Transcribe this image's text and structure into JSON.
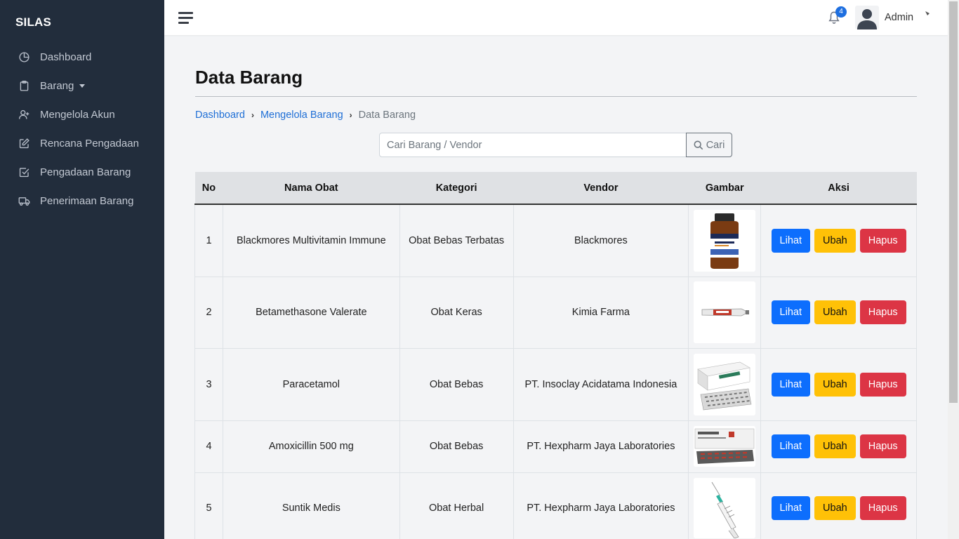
{
  "app": {
    "brand": "SILAS"
  },
  "sidebar": {
    "items": [
      {
        "label": "Dashboard",
        "icon": "pie-chart-icon"
      },
      {
        "label": "Barang",
        "icon": "clipboard-icon",
        "has_dropdown": true
      },
      {
        "label": "Mengelola Akun",
        "icon": "user-plus-icon"
      },
      {
        "label": "Rencana Pengadaan",
        "icon": "edit-icon"
      },
      {
        "label": "Pengadaan Barang",
        "icon": "check-square-icon"
      },
      {
        "label": "Penerimaan Barang",
        "icon": "truck-icon"
      }
    ]
  },
  "topbar": {
    "notification_count": "4",
    "username": "Admin"
  },
  "page": {
    "title": "Data Barang",
    "breadcrumb": [
      {
        "label": "Dashboard"
      },
      {
        "label": "Mengelola Barang"
      },
      {
        "label": "Data Barang"
      }
    ]
  },
  "search": {
    "placeholder": "Cari Barang / Vendor",
    "button_label": "Cari"
  },
  "table": {
    "headers": [
      "No",
      "Nama Obat",
      "Kategori",
      "Vendor",
      "Gambar",
      "Aksi"
    ],
    "action_labels": {
      "view": "Lihat",
      "edit": "Ubah",
      "delete": "Hapus"
    },
    "rows": [
      {
        "no": "1",
        "nama": "Blackmores Multivitamin Immune",
        "kategori": "Obat Bebas Terbatas",
        "vendor": "Blackmores",
        "image": "vitamin-bottle-image"
      },
      {
        "no": "2",
        "nama": "Betamethasone Valerate",
        "kategori": "Obat Keras",
        "vendor": "Kimia Farma",
        "image": "ointment-tube-image"
      },
      {
        "no": "3",
        "nama": "Paracetamol",
        "kategori": "Obat Bebas",
        "vendor": "PT. Insoclay Acidatama Indonesia",
        "image": "paracetamol-box-image"
      },
      {
        "no": "4",
        "nama": "Amoxicillin 500 mg",
        "kategori": "Obat Bebas",
        "vendor": "PT. Hexpharm Jaya Laboratories",
        "image": "amoxicillin-box-image"
      },
      {
        "no": "5",
        "nama": "Suntik Medis",
        "kategori": "Obat Herbal",
        "vendor": "PT. Hexpharm Jaya Laboratories",
        "image": "syringe-image"
      }
    ]
  },
  "colors": {
    "sidebar_bg": "#222d3c",
    "link": "#1f6fd6",
    "btn_view": "#0d6efd",
    "btn_edit": "#ffc107",
    "btn_delete": "#dc3545"
  }
}
